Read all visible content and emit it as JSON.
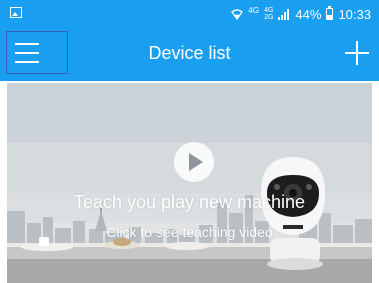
{
  "status_bar": {
    "network": "4G",
    "network_secondary": "4G",
    "network_tertiary": "2G",
    "battery": "44%",
    "time": "10:33"
  },
  "app_bar": {
    "title": "Device list",
    "menu_icon": "menu-icon",
    "add_icon": "plus-icon"
  },
  "banner": {
    "title": "Teach you play new machine",
    "subtitle": "Click to see teaching video",
    "play_icon": "play-icon"
  },
  "colors": {
    "primary": "#1a9ef0",
    "menu_highlight": "#3a5fb5"
  }
}
